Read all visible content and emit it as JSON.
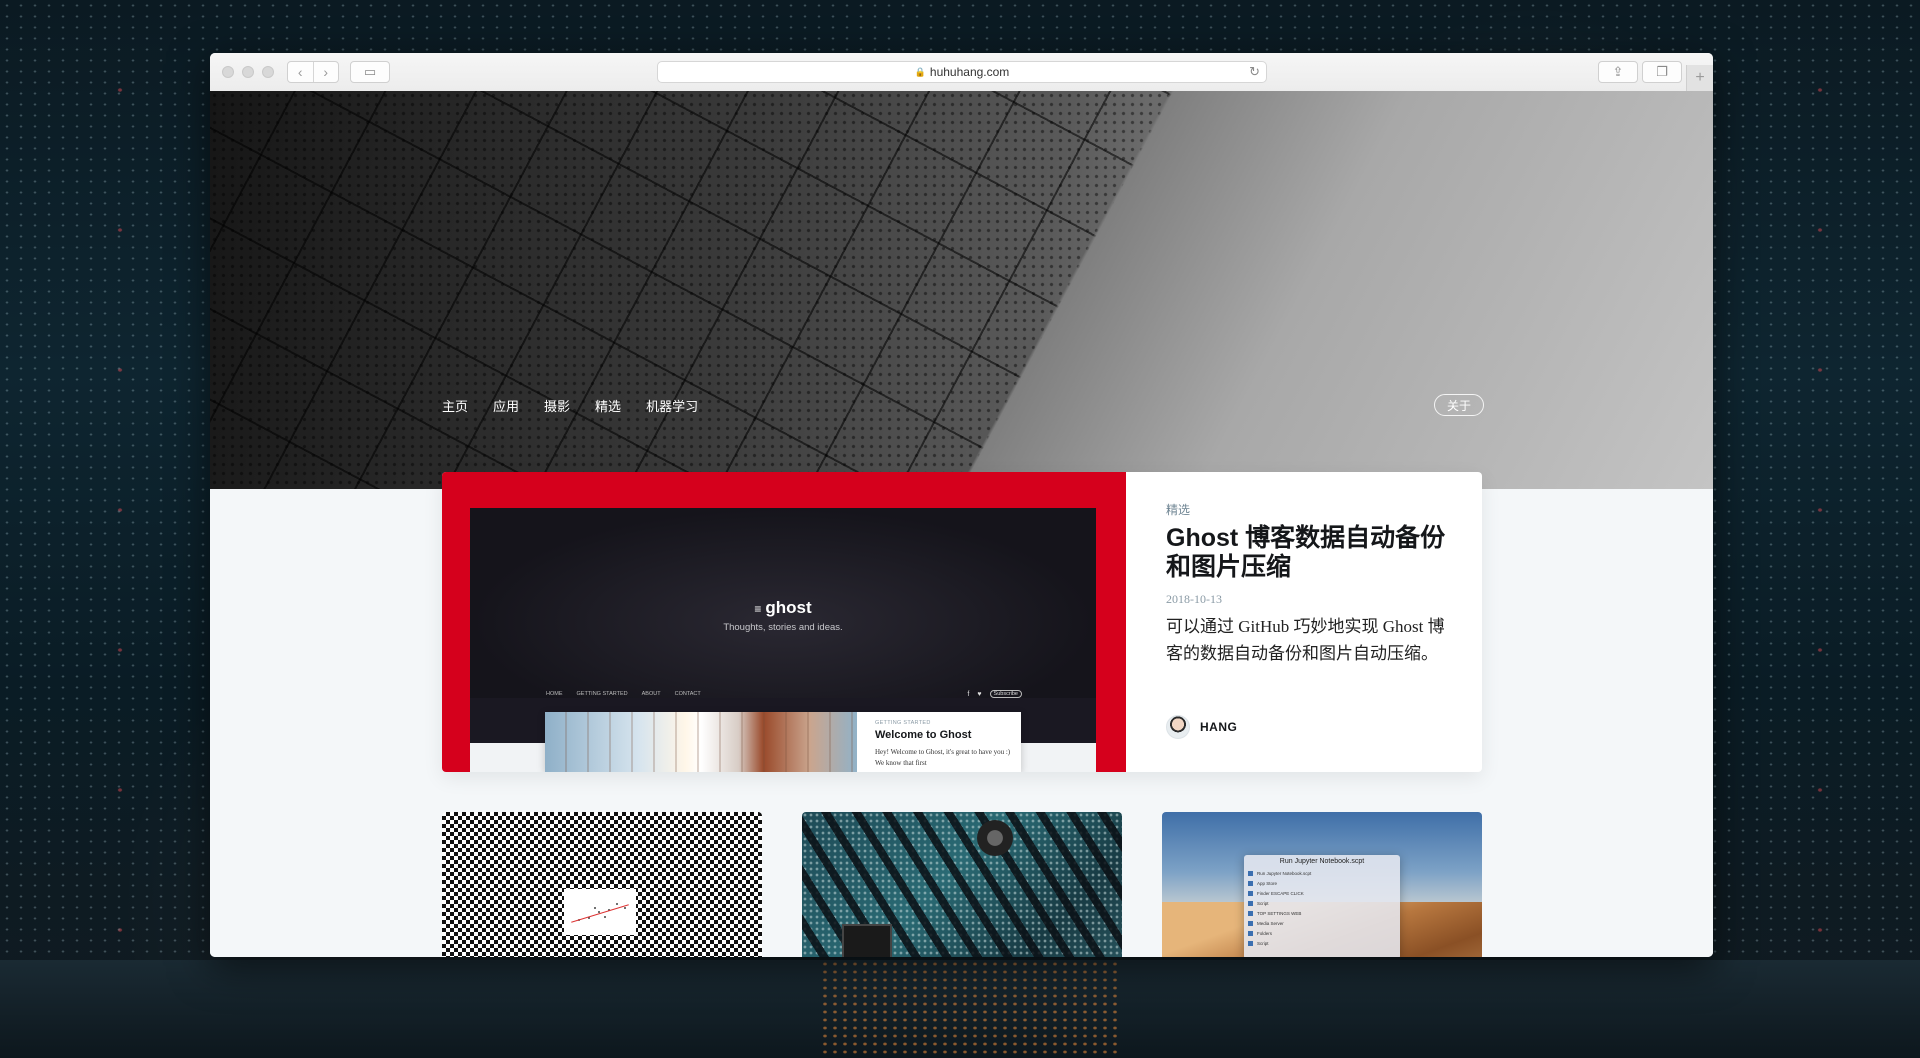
{
  "browser": {
    "url": "huhuhang.com"
  },
  "site": {
    "nav": [
      "主页",
      "应用",
      "摄影",
      "精选",
      "机器学习"
    ],
    "about_label": "关于"
  },
  "featured": {
    "tag": "精选",
    "title": "Ghost 博客数据自动备份和图片压缩",
    "date": "2018-10-13",
    "excerpt": "可以通过 GitHub 巧妙地实现 Ghost 博客的数据自动备份和图片自动压缩。",
    "author": "HANG",
    "image": {
      "logo_text": "ghost",
      "tagline": "Thoughts, stories and ideas.",
      "nav": [
        "HOME",
        "GETTING STARTED",
        "ABOUT",
        "CONTACT"
      ],
      "subscribe": "Subscribe",
      "card_kicker": "GETTING STARTED",
      "card_title": "Welcome to Ghost",
      "card_desc": "Hey! Welcome to Ghost, it's great to have you :) We know that first"
    }
  },
  "cards": [
    {
      "thumb": "chart-on-checkerboard"
    },
    {
      "thumb": "circuit-board"
    },
    {
      "thumb": "macos-desktop",
      "window_title": "Run Jupyter Notebook.scpt",
      "items": [
        "Run Jupyter Notebook.scpt",
        "App Store",
        "Finder ESCAPE CLICK",
        "Script",
        "TOP SETTINGS WEB",
        "Media Server",
        "Folders",
        "Script"
      ]
    }
  ],
  "colors": {
    "accent_red": "#d5001c",
    "page_bg": "#f4f7f9"
  }
}
